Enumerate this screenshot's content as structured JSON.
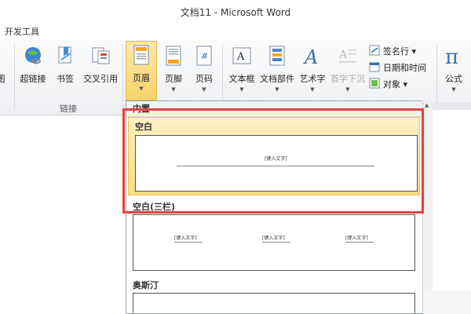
{
  "window": {
    "title": "文档11 - Microsoft Word"
  },
  "tabs": {
    "active": "开发工具"
  },
  "ribbon": {
    "left_cut_label": "图",
    "links_group": {
      "label": "链接",
      "buttons": [
        "超链接",
        "书签",
        "交叉引用"
      ]
    },
    "header_footer_group": {
      "buttons": [
        "页眉",
        "页脚",
        "页码"
      ]
    },
    "text_group": {
      "buttons": [
        "文本框",
        "文档部件",
        "艺术字",
        "首字下沉"
      ],
      "small": [
        "签名行 ▾",
        "日期和时间",
        "对象 ▾"
      ]
    },
    "symbols_group": {
      "buttons": [
        "公式"
      ]
    }
  },
  "gallery": {
    "section_builtin": "内置",
    "items": [
      {
        "name": "空白",
        "placeholder": "[键入文字]"
      },
      {
        "name": "空白(三栏)",
        "placeholder": "[键入文字]"
      },
      {
        "name": "奥斯汀"
      }
    ]
  },
  "colors": {
    "highlight_border": "#e2423d",
    "selected_fill": "#f9db82",
    "ribbon_bg": "#eef0f3"
  }
}
